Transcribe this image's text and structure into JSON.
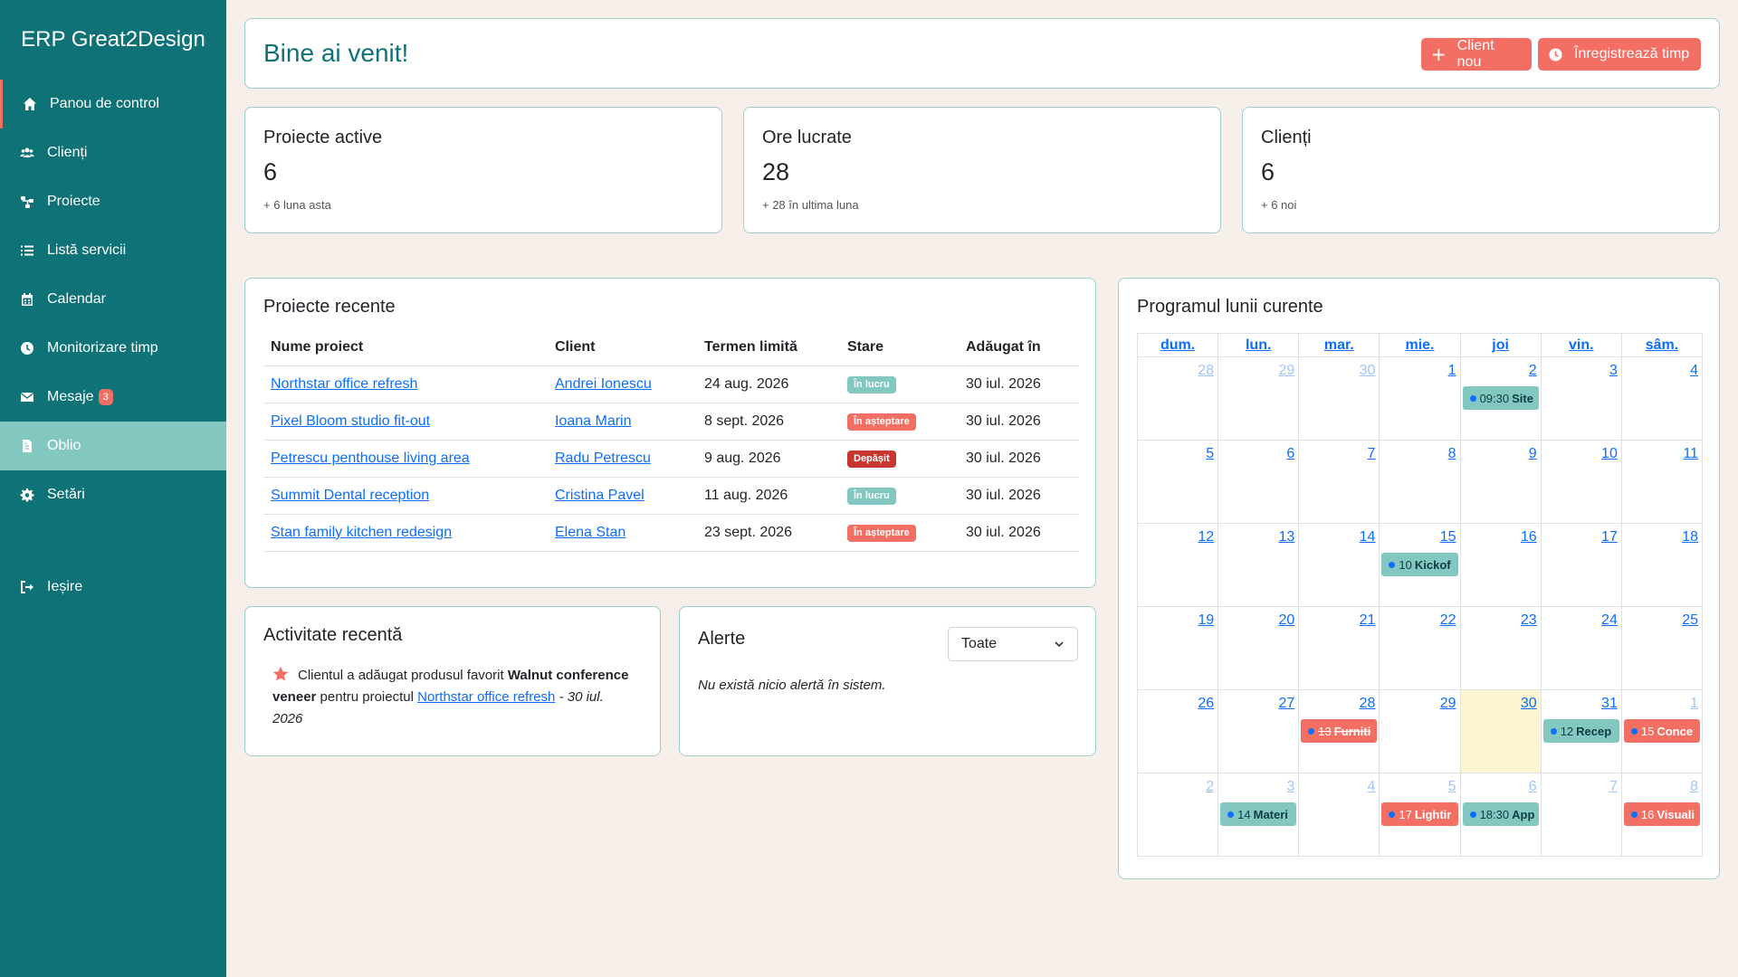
{
  "app": {
    "brand": "ERP Great2Design"
  },
  "sidebar": {
    "items": [
      {
        "label": "Panou de control",
        "icon": "home-icon"
      },
      {
        "label": "Clienți",
        "icon": "users-icon"
      },
      {
        "label": "Proiecte",
        "icon": "sitemap-icon"
      },
      {
        "label": "Listă servicii",
        "icon": "list-icon"
      },
      {
        "label": "Calendar",
        "icon": "calendar-icon"
      },
      {
        "label": "Monitorizare timp",
        "icon": "clock-icon"
      },
      {
        "label": "Mesaje",
        "icon": "envelope-icon",
        "badge": "3"
      },
      {
        "label": "Oblio",
        "icon": "invoice-icon"
      },
      {
        "label": "Setări",
        "icon": "gear-icon"
      }
    ],
    "logout": {
      "label": "Ieșire",
      "icon": "sign-out-icon"
    }
  },
  "header": {
    "title": "Bine ai venit!",
    "new_client": "Client nou",
    "log_time": "Înregistrează timp"
  },
  "stats": [
    {
      "label": "Proiecte active",
      "value": "6",
      "sub": "+ 6 luna asta"
    },
    {
      "label": "Ore lucrate",
      "value": "28",
      "sub": "+ 28 în ultima luna"
    },
    {
      "label": "Clienți",
      "value": "6",
      "sub": "+ 6 noi"
    }
  ],
  "recent_projects": {
    "title": "Proiecte recente",
    "columns": [
      "Nume proiect",
      "Client",
      "Termen limită",
      "Stare",
      "Adăugat în"
    ],
    "rows": [
      {
        "name": "Northstar office refresh",
        "client": "Andrei Ionescu",
        "deadline": "24 aug. 2026",
        "status": "În lucru",
        "added": "30 iul. 2026"
      },
      {
        "name": "Pixel Bloom studio fit-out",
        "client": "Ioana Marin",
        "deadline": "8 sept. 2026",
        "status": "În așteptare",
        "added": "30 iul. 2026"
      },
      {
        "name": "Petrescu penthouse living area",
        "client": "Radu Petrescu",
        "deadline": "9 aug. 2026",
        "status": "Depășit",
        "added": "30 iul. 2026"
      },
      {
        "name": "Summit Dental reception",
        "client": "Cristina Pavel",
        "deadline": "11 aug. 2026",
        "status": "În lucru",
        "added": "30 iul. 2026"
      },
      {
        "name": "Stan family kitchen redesign",
        "client": "Elena Stan",
        "deadline": "23 sept. 2026",
        "status": "În așteptare",
        "added": "30 iul. 2026"
      }
    ],
    "status_colors": {
      "În lucru": "#83c7c1",
      "În așteptare": "#f36e63",
      "Depășit": "#c7362f"
    }
  },
  "activity": {
    "title": "Activitate recentă",
    "text_before": "Clientul a adăugat produsul favorit ",
    "product": "Walnut conference veneer",
    "text_middle": " pentru proiectul ",
    "project_link": "Northstar office refresh",
    "date": " - 30 iul. 2026"
  },
  "alerts": {
    "title": "Alerte",
    "filter": "Toate",
    "empty": "Nu există nicio alertă în sistem."
  },
  "calendar": {
    "title": "Programul lunii curente",
    "weekdays": [
      "dum.",
      "lun.",
      "mar.",
      "mie.",
      "joi",
      "vin.",
      "sâm."
    ],
    "weeks": [
      [
        "28",
        "29",
        "30",
        "1",
        "2",
        "3",
        "4"
      ],
      [
        "5",
        "6",
        "7",
        "8",
        "9",
        "10",
        "11"
      ],
      [
        "12",
        "13",
        "14",
        "15",
        "16",
        "17",
        "18"
      ],
      [
        "19",
        "20",
        "21",
        "22",
        "23",
        "24",
        "25"
      ],
      [
        "26",
        "27",
        "28",
        "29",
        "30",
        "31",
        "1"
      ],
      [
        "2",
        "3",
        "4",
        "5",
        "6",
        "7",
        "8"
      ]
    ],
    "muted": [
      [
        0,
        0
      ],
      [
        0,
        1
      ],
      [
        0,
        2
      ],
      [
        4,
        6
      ],
      [
        5,
        0
      ],
      [
        5,
        1
      ],
      [
        5,
        2
      ],
      [
        5,
        3
      ],
      [
        5,
        4
      ],
      [
        5,
        5
      ],
      [
        5,
        6
      ]
    ],
    "today": [
      4,
      4
    ],
    "events": [
      {
        "week": 0,
        "day": 4,
        "time": "09:30",
        "title": "Site",
        "color": "teal"
      },
      {
        "week": 2,
        "day": 3,
        "time": "10",
        "title": "Kickof",
        "color": "teal"
      },
      {
        "week": 4,
        "day": 2,
        "time": "13",
        "title": "Furniti",
        "color": "red",
        "strike": true
      },
      {
        "week": 4,
        "day": 5,
        "time": "12",
        "title": "Recep",
        "color": "teal"
      },
      {
        "week": 4,
        "day": 6,
        "time": "15",
        "title": "Conce",
        "color": "red"
      },
      {
        "week": 5,
        "day": 1,
        "time": "14",
        "title": "Materi",
        "color": "teal"
      },
      {
        "week": 5,
        "day": 3,
        "time": "17",
        "title": "Lightir",
        "color": "red"
      },
      {
        "week": 5,
        "day": 4,
        "time": "18:30",
        "title": "App",
        "color": "teal"
      },
      {
        "week": 5,
        "day": 6,
        "time": "16",
        "title": "Visuali",
        "color": "red"
      }
    ]
  },
  "colors": {
    "sidebar": "#0e7277",
    "accent": "#f36e63",
    "highlight": "#83c7c1",
    "background": "#f7efe9"
  }
}
